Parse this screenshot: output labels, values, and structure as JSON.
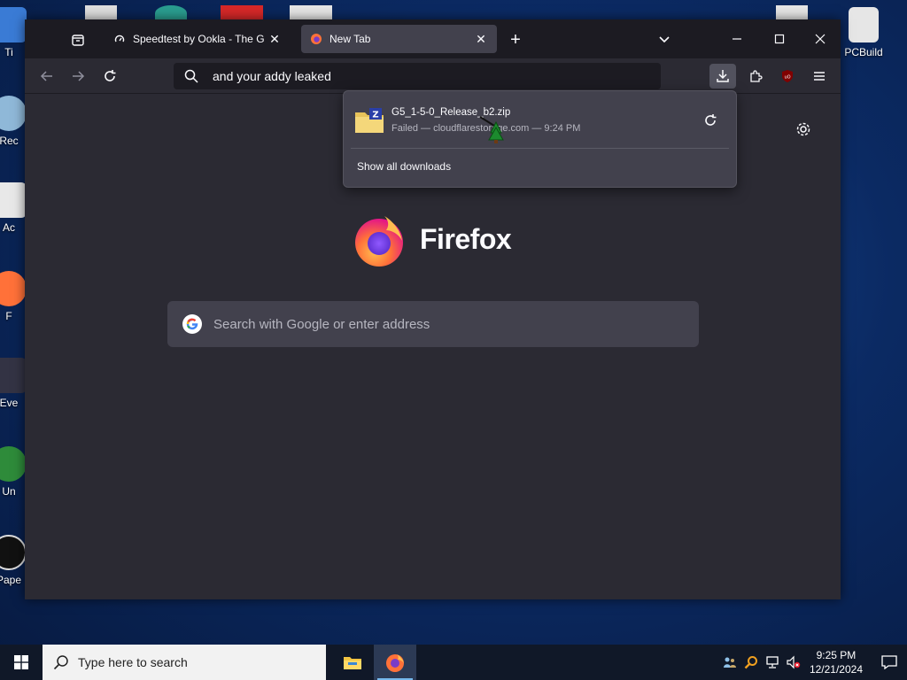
{
  "desktop": {
    "right_icons": [
      {
        "label": "PCBuild"
      }
    ],
    "left_icons": [
      {
        "label": "Ti"
      },
      {
        "label": "Rec"
      },
      {
        "label": "Ac"
      },
      {
        "label": "F"
      },
      {
        "label": "Eve"
      },
      {
        "label": "Un"
      },
      {
        "label": "Pape"
      }
    ]
  },
  "browser": {
    "tabs": [
      {
        "title": "Speedtest by Ookla - The Global",
        "active": false
      },
      {
        "title": "New Tab",
        "active": true
      }
    ],
    "new_tab_label": "+",
    "url_text": "and your addy leaked",
    "brand": "Firefox",
    "search_placeholder": "Search with Google or enter address",
    "downloads_panel": {
      "file_name": "G5_1-5-0_Release_b2.zip",
      "status": "Failed — cloudflarestorage.com — 9:24 PM",
      "show_all": "Show all downloads"
    }
  },
  "taskbar": {
    "search_placeholder": "Type here to search",
    "time": "9:25 PM",
    "date": "12/21/2024"
  },
  "colors": {
    "toolbar_bg": "#2b2a33",
    "tabbar_bg": "#1c1b22",
    "panel_bg": "#42414d",
    "accent": "#76b9ed"
  }
}
